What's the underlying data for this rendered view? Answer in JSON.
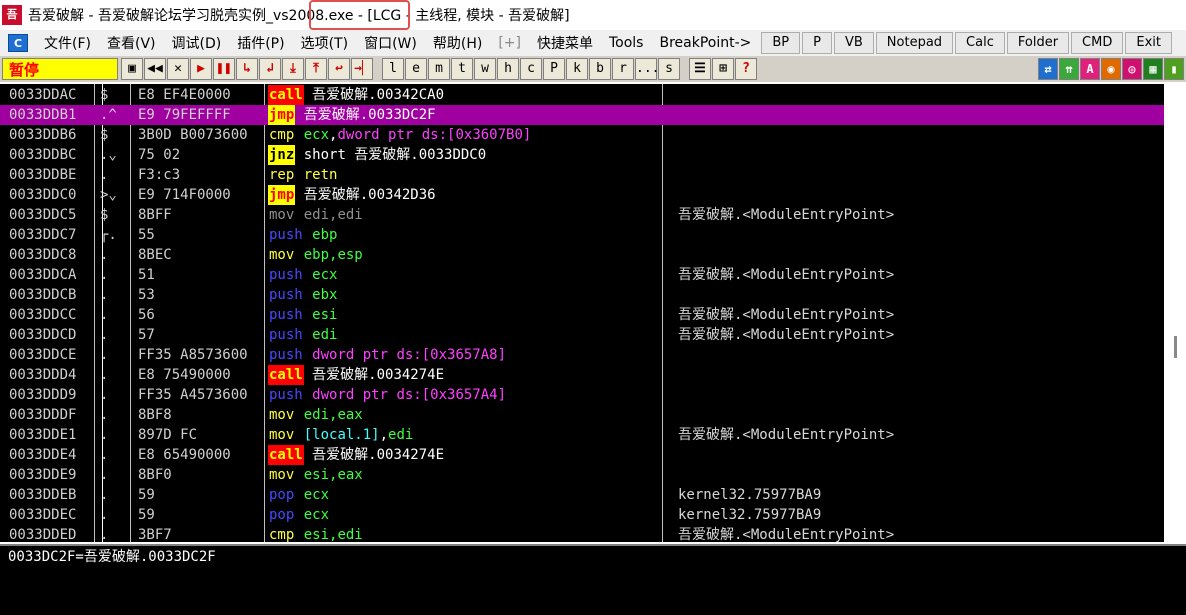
{
  "window": {
    "logo": "吾",
    "title": "吾爱破解 - 吾爱破解论坛学习脱壳实例_vs2008.exe - [LCG - 主线程, 模块 - 吾爱破解]"
  },
  "menubar": {
    "items": [
      "文件(F)",
      "查看(V)",
      "调试(D)",
      "插件(P)",
      "选项(T)",
      "窗口(W)",
      "帮助(H)",
      "[+]",
      "快捷菜单",
      "Tools",
      "BreakPoint->"
    ],
    "buttons": [
      "BP",
      "P",
      "VB",
      "Notepad",
      "Calc",
      "Folder",
      "CMD",
      "Exit"
    ]
  },
  "toolbar": {
    "status": "暂停",
    "buttons": [
      "▣",
      "◀◀",
      "✕",
      "▶",
      "❚❚",
      "↳",
      "↲",
      "⤓",
      "⤒",
      "↩",
      "→▏"
    ],
    "letters": [
      "l",
      "e",
      "m",
      "t",
      "w",
      "h",
      "c",
      "P",
      "k",
      "b",
      "r",
      "...",
      "s"
    ],
    "right_buttons": [
      "☰",
      "⊞",
      "?"
    ],
    "color_buttons": [
      {
        "label": "⇄",
        "color": "#1f6fd1"
      },
      {
        "label": "⇈",
        "color": "#3aa83a"
      },
      {
        "label": "A",
        "color": "#e0207a"
      },
      {
        "label": "◉",
        "color": "#e06a00"
      },
      {
        "label": "◎",
        "color": "#d01070"
      },
      {
        "label": "▦",
        "color": "#208020"
      },
      {
        "label": "▮",
        "color": "#50a020"
      }
    ]
  },
  "disasm": {
    "rows": [
      {
        "addr": "0033DDAC",
        "mark": "$",
        "hex": "E8 EF4E0000",
        "mn": "call",
        "mc": "call",
        "ops": [
          {
            "t": "吾爱破解.00342CA0",
            "c": "opw"
          }
        ],
        "cmt": ""
      },
      {
        "addr": "0033DDB1",
        "mark": ".^",
        "hex": "E9 79FEFFFF",
        "mn": "jmp",
        "mc": "jmp",
        "ops": [
          {
            "t": "吾爱破解.0033DC2F",
            "c": "opw"
          }
        ],
        "cmt": "",
        "sel": true
      },
      {
        "addr": "0033DDB6",
        "mark": "$",
        "hex": "3B0D B0073600",
        "mn": "cmp",
        "mc": "cmp",
        "ops": [
          {
            "t": "ecx",
            "c": "opy"
          },
          {
            "t": ",",
            "c": "opw"
          },
          {
            "t": "dword ptr ds:[0x3607B0]",
            "c": "opm"
          }
        ],
        "cmt": ""
      },
      {
        "addr": "0033DDBC",
        "mark": ".⌄",
        "hex": "75 02",
        "mn": "jnz",
        "mc": "jcc",
        "ops": [
          {
            "t": "short 吾爱破解.0033DDC0",
            "c": "opw"
          }
        ],
        "cmt": ""
      },
      {
        "addr": "0033DDBE",
        "mark": ".",
        "hex": "F3:c3",
        "mn": "rep",
        "mc": "rep",
        "ops": [
          {
            "t": "retn",
            "c": "rep"
          }
        ],
        "cmt": ""
      },
      {
        "addr": "0033DDC0",
        "mark": ">⌄",
        "hex": "E9 714F0000",
        "mn": "jmp",
        "mc": "jmp",
        "ops": [
          {
            "t": "吾爱破解.00342D36",
            "c": "opw"
          }
        ],
        "cmt": ""
      },
      {
        "addr": "0033DDC5",
        "mark": "$",
        "hex": "8BFF",
        "mn": "mov",
        "mc": "movg",
        "ops": [
          {
            "t": "edi,edi",
            "c": "movg"
          }
        ],
        "cmt": "吾爱破解.<ModuleEntryPoint>"
      },
      {
        "addr": "0033DDC7",
        "mark": "┌.",
        "hex": "55",
        "mn": "push",
        "mc": "push",
        "ops": [
          {
            "t": "ebp",
            "c": "opy"
          }
        ],
        "cmt": ""
      },
      {
        "addr": "0033DDC8",
        "mark": ".",
        "hex": "8BEC",
        "mn": "mov",
        "mc": "mov",
        "ops": [
          {
            "t": "ebp,esp",
            "c": "opy"
          }
        ],
        "cmt": ""
      },
      {
        "addr": "0033DDCA",
        "mark": ".",
        "hex": "51",
        "mn": "push",
        "mc": "push",
        "ops": [
          {
            "t": "ecx",
            "c": "opy"
          }
        ],
        "cmt": "吾爱破解.<ModuleEntryPoint>"
      },
      {
        "addr": "0033DDCB",
        "mark": ".",
        "hex": "53",
        "mn": "push",
        "mc": "push",
        "ops": [
          {
            "t": "ebx",
            "c": "opy"
          }
        ],
        "cmt": ""
      },
      {
        "addr": "0033DDCC",
        "mark": ".",
        "hex": "56",
        "mn": "push",
        "mc": "push",
        "ops": [
          {
            "t": "esi",
            "c": "opy"
          }
        ],
        "cmt": "吾爱破解.<ModuleEntryPoint>"
      },
      {
        "addr": "0033DDCD",
        "mark": ".",
        "hex": "57",
        "mn": "push",
        "mc": "push",
        "ops": [
          {
            "t": "edi",
            "c": "opy"
          }
        ],
        "cmt": "吾爱破解.<ModuleEntryPoint>"
      },
      {
        "addr": "0033DDCE",
        "mark": ".",
        "hex": "FF35 A8573600",
        "mn": "push",
        "mc": "push",
        "ops": [
          {
            "t": "dword ptr ds:[0x3657A8]",
            "c": "opm"
          }
        ],
        "cmt": ""
      },
      {
        "addr": "0033DDD4",
        "mark": ".",
        "hex": "E8 75490000",
        "mn": "call",
        "mc": "call",
        "ops": [
          {
            "t": "吾爱破解.0034274E",
            "c": "opw"
          }
        ],
        "cmt": ""
      },
      {
        "addr": "0033DDD9",
        "mark": ".",
        "hex": "FF35 A4573600",
        "mn": "push",
        "mc": "push",
        "ops": [
          {
            "t": "dword ptr ds:[0x3657A4]",
            "c": "opm"
          }
        ],
        "cmt": ""
      },
      {
        "addr": "0033DDDF",
        "mark": ".",
        "hex": "8BF8",
        "mn": "mov",
        "mc": "mov",
        "ops": [
          {
            "t": "edi,eax",
            "c": "opy"
          }
        ],
        "cmt": ""
      },
      {
        "addr": "0033DDE1",
        "mark": ".",
        "hex": "897D FC",
        "mn": "mov",
        "mc": "mov",
        "ops": [
          {
            "t": "[local.1]",
            "c": "opc"
          },
          {
            "t": ",",
            "c": "opw"
          },
          {
            "t": "edi",
            "c": "opy"
          }
        ],
        "cmt": "吾爱破解.<ModuleEntryPoint>"
      },
      {
        "addr": "0033DDE4",
        "mark": ".",
        "hex": "E8 65490000",
        "mn": "call",
        "mc": "call",
        "ops": [
          {
            "t": "吾爱破解.0034274E",
            "c": "opw"
          }
        ],
        "cmt": ""
      },
      {
        "addr": "0033DDE9",
        "mark": ".",
        "hex": "8BF0",
        "mn": "mov",
        "mc": "mov",
        "ops": [
          {
            "t": "esi,eax",
            "c": "opy"
          }
        ],
        "cmt": ""
      },
      {
        "addr": "0033DDEB",
        "mark": ".",
        "hex": "59",
        "mn": "pop",
        "mc": "pop",
        "ops": [
          {
            "t": "ecx",
            "c": "opy"
          }
        ],
        "cmt": "kernel32.75977BA9"
      },
      {
        "addr": "0033DDEC",
        "mark": ".",
        "hex": "59",
        "mn": "pop",
        "mc": "pop",
        "ops": [
          {
            "t": "ecx",
            "c": "opy"
          }
        ],
        "cmt": "kernel32.75977BA9"
      },
      {
        "addr": "0033DDED",
        "mark": ".",
        "hex": "3BF7",
        "mn": "cmp",
        "mc": "cmp",
        "ops": [
          {
            "t": "esi,edi",
            "c": "opy"
          }
        ],
        "cmt": "吾爱破解.<ModuleEntryPoint>"
      }
    ]
  },
  "info": {
    "text": "0033DC2F=吾爱破解.0033DC2F"
  }
}
